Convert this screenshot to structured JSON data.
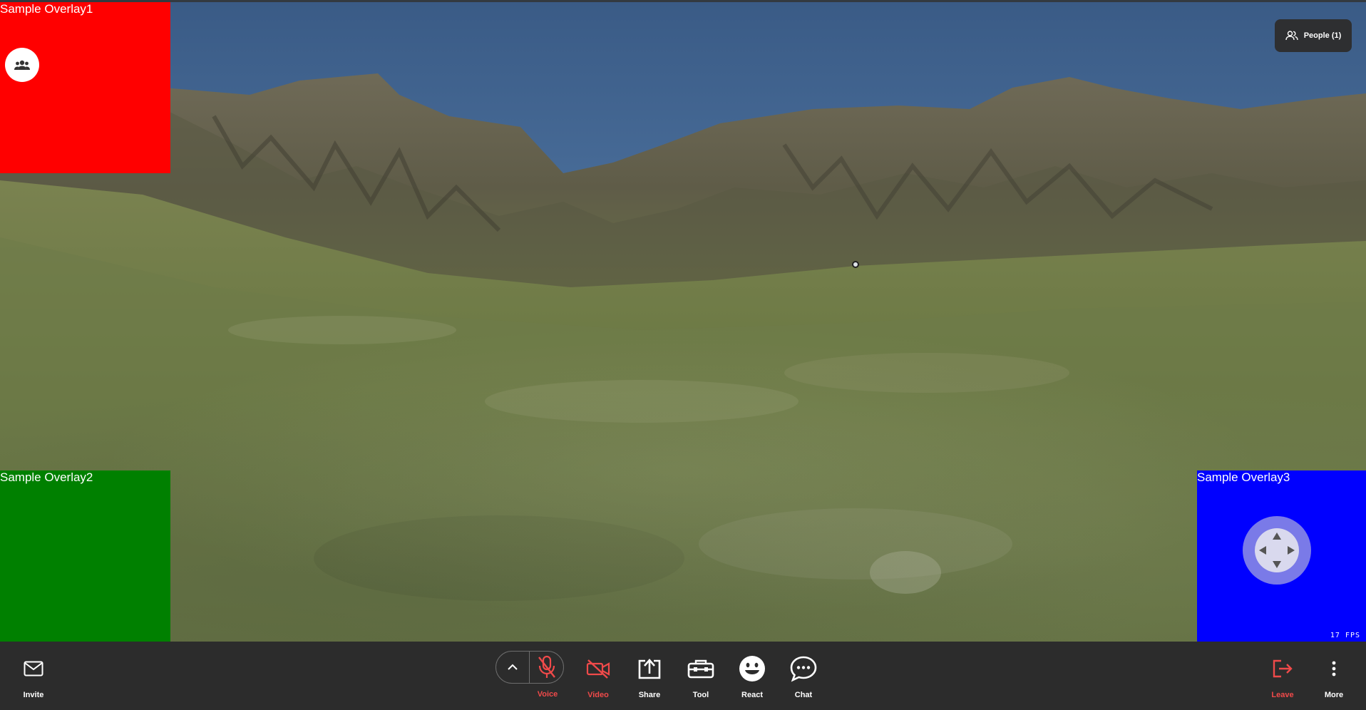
{
  "overlays": {
    "overlay1": {
      "label": "Sample Overlay1",
      "color": "#ff0000"
    },
    "overlay2": {
      "label": "Sample Overlay2",
      "color": "#008000"
    },
    "overlay3": {
      "label": "Sample Overlay3",
      "color": "#0000ff",
      "fps": "17 FPS"
    }
  },
  "people_button": {
    "label": "People (1)",
    "icon": "people-icon"
  },
  "toolbar": {
    "invite": {
      "label": "Invite",
      "icon": "mail-icon"
    },
    "voice": {
      "label": "Voice",
      "icon": "mic-off-icon",
      "caret_icon": "chevron-up-icon"
    },
    "video": {
      "label": "Video",
      "icon": "video-off-icon"
    },
    "share": {
      "label": "Share",
      "icon": "share-screen-icon"
    },
    "tool": {
      "label": "Tool",
      "icon": "toolbox-icon"
    },
    "react": {
      "label": "React",
      "icon": "smiley-icon"
    },
    "chat": {
      "label": "Chat",
      "icon": "chat-bubble-icon"
    },
    "leave": {
      "label": "Leave",
      "icon": "logout-icon"
    },
    "more": {
      "label": "More",
      "icon": "more-vertical-icon"
    }
  },
  "colors": {
    "toolbar_bg": "#2c2c2c",
    "danger": "#f04a4a"
  }
}
